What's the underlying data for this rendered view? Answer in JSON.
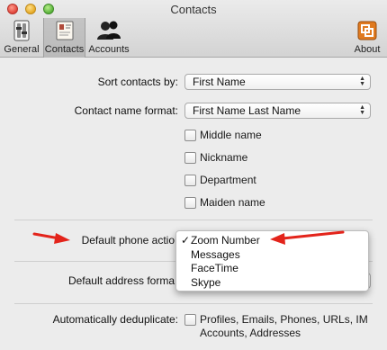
{
  "window": {
    "title": "Contacts"
  },
  "toolbar": {
    "general_label": "General",
    "contacts_label": "Contacts",
    "accounts_label": "Accounts",
    "about_label": "About"
  },
  "form": {
    "sort_label": "Sort contacts by:",
    "sort_value": "First Name",
    "name_format_label": "Contact name format:",
    "name_format_value": "First Name Last Name",
    "checkboxes": [
      {
        "label": "Middle name",
        "checked": false
      },
      {
        "label": "Nickname",
        "checked": false
      },
      {
        "label": "Department",
        "checked": false
      },
      {
        "label": "Maiden name",
        "checked": false
      }
    ],
    "phone_action_label": "Default phone actio",
    "phone_action_menu": {
      "items": [
        "Zoom Number",
        "Messages",
        "FaceTime",
        "Skype"
      ],
      "selected_index": 0,
      "check_mark": "✓"
    },
    "address_format_label": "Default address forma",
    "dedup_label": "Automatically deduplicate:",
    "dedup_option_line1": "Profiles, Emails, Phones, URLs, IM",
    "dedup_option_line2": "Accounts, Addresses"
  },
  "colors": {
    "annotation_arrow": "#e3241b"
  }
}
